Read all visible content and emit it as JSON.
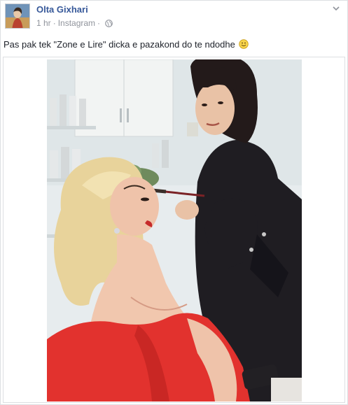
{
  "post": {
    "author": "Olta Gixhari",
    "time": "1 hr",
    "separator": "·",
    "source": "Instagram",
    "message": "Pas pak tek \"Zone e Lire\" dicka e pazakond do te ndodhe",
    "icons": {
      "avatar": "profile-picture",
      "privacy": "globe-icon",
      "menu": "chevron-down-icon",
      "emoji": "smiley-icon"
    },
    "colors": {
      "name": "#365899",
      "meta": "#90949c",
      "text": "#1d2129",
      "border": "#dddfe2"
    }
  }
}
